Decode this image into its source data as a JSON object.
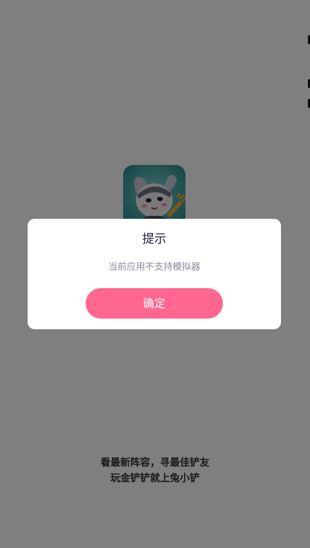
{
  "splash": {
    "logo_icon": "rabbit-mascot-icon",
    "tagline_line1": "看最新阵容，寻最佳铲友",
    "tagline_line2": "玩金铲铲就上兔小铲"
  },
  "dialog": {
    "title": "提示",
    "message": "当前应用不支持模拟器",
    "confirm_label": "确定"
  },
  "colors": {
    "overlay": "#808080",
    "confirm_button": "#ff6690",
    "logo_background": "#3aa6a8"
  }
}
